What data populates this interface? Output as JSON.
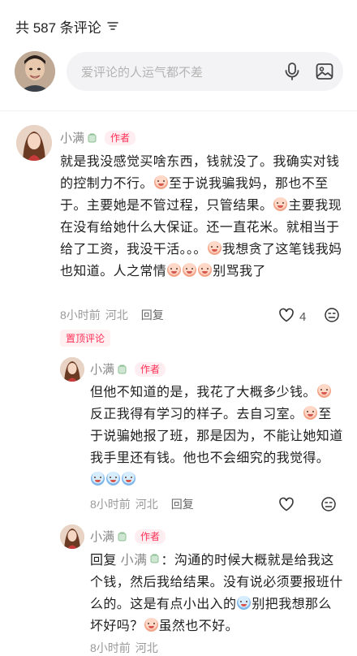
{
  "header": {
    "count_label": "共 587 条评论"
  },
  "input": {
    "placeholder": "爱评论的人运气都不差"
  },
  "comments": [
    {
      "name": "小满",
      "badge": "作者",
      "segments": [
        {
          "t": "就是我没感觉买啥东西，钱就没了。我确实对钱的控制力不行。"
        },
        {
          "e": "laugh-cry-emoji"
        },
        {
          "t": "至于说我骗我妈，那也不至于。主要她是不管过程，只管结果。"
        },
        {
          "e": "laugh-cry-emoji"
        },
        {
          "t": "主要我现在没有给她什么大保证。还一直花米。就相当于给了工资，我没干活。。。"
        },
        {
          "e": "laugh-cry-emoji"
        },
        {
          "t": "我想贪了这笔钱我妈也知道。人之常情"
        },
        {
          "e": "laugh-cry-emoji"
        },
        {
          "e": "laugh-cry-emoji"
        },
        {
          "e": "laugh-cry-emoji"
        },
        {
          "t": "别骂我了"
        }
      ],
      "time": "8小时前",
      "location": "河北",
      "reply_label": "回复",
      "likes": "4",
      "pin_label": "置顶评论"
    },
    {
      "name": "小满",
      "badge": "作者",
      "segments": [
        {
          "t": "但他不知道的是，我花了大概多少钱。"
        },
        {
          "e": "laugh-cry-emoji"
        },
        {
          "t": "反正我得有学习的样子。去自习室。"
        },
        {
          "e": "laugh-cry-emoji"
        },
        {
          "t": "至于说骗她报了班，那是因为，不能让她知道我手里还有钱。他也不会细究的我觉得。"
        },
        {
          "e": "blue-cry-emoji"
        },
        {
          "e": "blue-cry-emoji"
        },
        {
          "e": "blue-cry-emoji"
        }
      ],
      "time": "8小时前",
      "location": "河北",
      "reply_label": "回复"
    },
    {
      "name": "小满",
      "badge": "作者",
      "reply_prefix": "回复",
      "reply_target": "小满",
      "segments": [
        {
          "t": "：沟通的时候大概就是给我这个钱，然后我给结果。没有说必须要报班什么的。这是有点小出入的"
        },
        {
          "e": "blue-cry-emoji"
        },
        {
          "t": "别把我想那么坏好吗？"
        },
        {
          "e": "laugh-cry-emoji"
        },
        {
          "t": "虽然也不好。"
        }
      ],
      "time": "8小时前",
      "location": "河北"
    }
  ],
  "colors": {
    "accent": "#ff2e55",
    "muted": "#999999",
    "input_bg": "#f3f3f5"
  }
}
